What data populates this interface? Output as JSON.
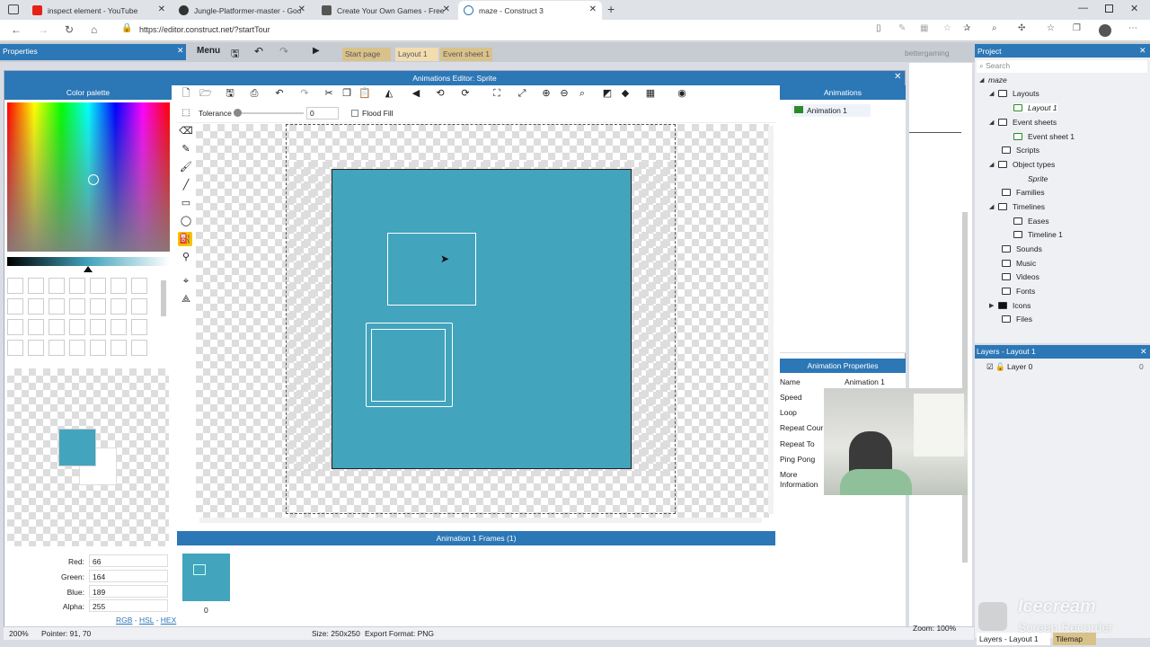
{
  "browser": {
    "tabs": [
      {
        "title": "inspect element - YouTube"
      },
      {
        "title": "Jungle-Platformer-master - Goo"
      },
      {
        "title": "Create Your Own Games - Free"
      },
      {
        "title": "maze - Construct 3"
      }
    ],
    "url": "https://editor.construct.net/?startTour"
  },
  "app": {
    "menu_label": "Menu",
    "doc_tabs": [
      "Start page",
      "Layout 1",
      "Event sheet 1"
    ],
    "user": "bettergaming",
    "left_panel_title": "Properties",
    "project_title": "Project"
  },
  "editor": {
    "title": "Animations Editor: Sprite",
    "tolerance_label": "Tolerance",
    "tolerance_value": "0",
    "flood_fill_label": "Flood Fill",
    "color_palette_title": "Color palette",
    "color": {
      "hex": "#42a4bd"
    },
    "rgb": {
      "red_label": "Red:",
      "red": "66",
      "green_label": "Green:",
      "green": "164",
      "blue_label": "Blue:",
      "blue": "189",
      "alpha_label": "Alpha:",
      "alpha": "255"
    },
    "modes": {
      "rgb": "RGB",
      "hsl": "HSL",
      "hex": "HEX"
    },
    "frames_title": "Animation 1 Frames (1)",
    "frame_index": "0",
    "animations_title": "Animations",
    "animation_item": "Animation 1",
    "props_title": "Animation Properties",
    "props": [
      {
        "name": "Name",
        "value": "Animation 1"
      },
      {
        "name": "Speed",
        "value": ""
      },
      {
        "name": "Loop",
        "value": ""
      },
      {
        "name": "Repeat Cour",
        "value": ""
      },
      {
        "name": "Repeat To",
        "value": ""
      },
      {
        "name": "Ping Pong",
        "value": ""
      },
      {
        "name": "More Information",
        "value": ""
      }
    ]
  },
  "status": {
    "zoom": "200%",
    "pointer": "Pointer: 91, 70",
    "size": "Size: 250x250",
    "export": "Export Format: PNG",
    "zoom_right": "Zoom: 100%"
  },
  "project": {
    "search_placeholder": "Search",
    "root": "maze",
    "items": [
      "Layouts",
      "Layout 1",
      "Event sheets",
      "Event sheet 1",
      "Scripts",
      "Object types",
      "Sprite",
      "Families",
      "Timelines",
      "Eases",
      "Timeline 1",
      "Sounds",
      "Music",
      "Videos",
      "Fonts",
      "Icons",
      "Files"
    ]
  },
  "layers": {
    "title": "Layers - Layout 1",
    "layer": "Layer 0",
    "count": "0",
    "bottom_tabs": [
      "Layers - Layout 1",
      "Tilemap"
    ]
  },
  "watermark": {
    "line1": "Icecream",
    "line2": "Screen Recorder"
  }
}
